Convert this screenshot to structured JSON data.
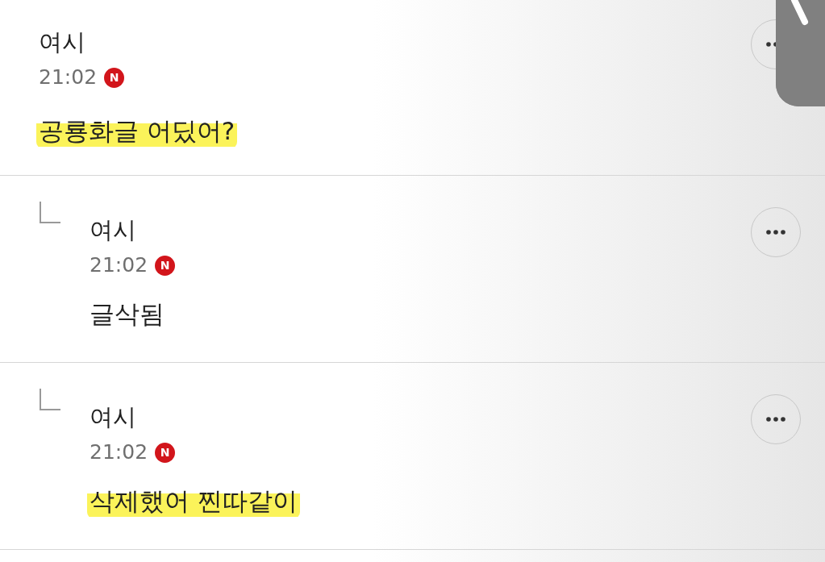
{
  "comments": [
    {
      "kind": "comment",
      "author": "여시",
      "time": "21:02",
      "badge": "N",
      "text": "공룡화글 어딨어?",
      "highlighted": true
    },
    {
      "kind": "reply",
      "author": "여시",
      "time": "21:02",
      "badge": "N",
      "text": "글삭됨",
      "highlighted": false
    },
    {
      "kind": "reply",
      "author": "여시",
      "time": "21:02",
      "badge": "N",
      "text": "삭제했어 찐따같이",
      "highlighted": true
    }
  ]
}
